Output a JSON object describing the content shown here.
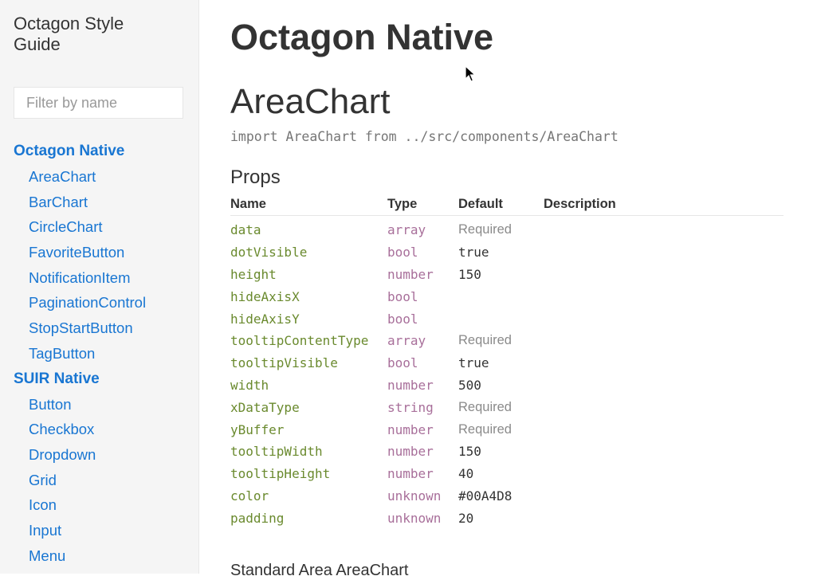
{
  "sidebar": {
    "title": "Octagon Style Guide",
    "filter_placeholder": "Filter by name",
    "sections": [
      {
        "label": "Octagon Native",
        "items": [
          "AreaChart",
          "BarChart",
          "CircleChart",
          "FavoriteButton",
          "NotificationItem",
          "PaginationControl",
          "StopStartButton",
          "TagButton"
        ]
      },
      {
        "label": "SUIR Native",
        "items": [
          "Button",
          "Checkbox",
          "Dropdown",
          "Grid",
          "Icon",
          "Input",
          "Menu"
        ]
      }
    ]
  },
  "main": {
    "page_title": "Octagon Native",
    "component_title": "AreaChart",
    "import_line": "import AreaChart from ../src/components/AreaChart",
    "props_heading": "Props",
    "table_headers": [
      "Name",
      "Type",
      "Default",
      "Description"
    ],
    "props": [
      {
        "name": "data",
        "type": "array",
        "default": "Required",
        "required": true
      },
      {
        "name": "dotVisible",
        "type": "bool",
        "default": "true",
        "required": false
      },
      {
        "name": "height",
        "type": "number",
        "default": "150",
        "required": false
      },
      {
        "name": "hideAxisX",
        "type": "bool",
        "default": "",
        "required": false
      },
      {
        "name": "hideAxisY",
        "type": "bool",
        "default": "",
        "required": false
      },
      {
        "name": "tooltipContentType",
        "type": "array",
        "default": "Required",
        "required": true
      },
      {
        "name": "tooltipVisible",
        "type": "bool",
        "default": "true",
        "required": false
      },
      {
        "name": "width",
        "type": "number",
        "default": "500",
        "required": false
      },
      {
        "name": "xDataType",
        "type": "string",
        "default": "Required",
        "required": true
      },
      {
        "name": "yBuffer",
        "type": "number",
        "default": "Required",
        "required": true
      },
      {
        "name": "tooltipWidth",
        "type": "number",
        "default": "150",
        "required": false
      },
      {
        "name": "tooltipHeight",
        "type": "number",
        "default": "40",
        "required": false
      },
      {
        "name": "color",
        "type": "unknown",
        "default": "#00A4D8",
        "required": false
      },
      {
        "name": "padding",
        "type": "unknown",
        "default": "20",
        "required": false
      }
    ],
    "example_heading": "Standard Area AreaChart"
  },
  "colors": {
    "link": "#1976d2",
    "prop_name": "#6a8a2e",
    "prop_type": "#a86f9a",
    "required": "#8a8a8a"
  },
  "icons": [
    "mouse-cursor-icon"
  ]
}
